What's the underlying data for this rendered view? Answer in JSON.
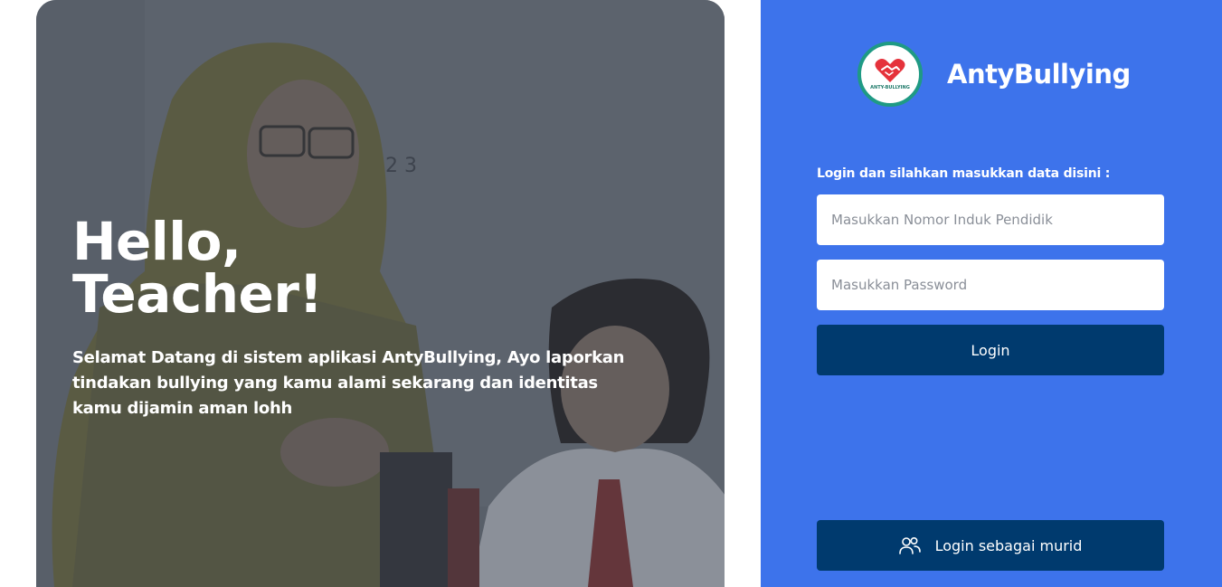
{
  "hero": {
    "title_line1": "Hello,",
    "title_line2": "Teacher!",
    "subtitle": "Selamat Datang di sistem aplikasi AntyBullying, Ayo laporkan tindakan bullying yang kamu alami sekarang dan identitas kamu dijamin aman lohh",
    "photo_text": "1 2 3"
  },
  "brand": {
    "name": "AntyBullying",
    "logo_text": "ANTY-BULLYING",
    "logo_icon": "heart-handshake-icon"
  },
  "login": {
    "prompt": "Login dan silahkan masukkan data disini :",
    "nip_placeholder": "Masukkan Nomor Induk Pendidik",
    "password_placeholder": "Masukkan Password",
    "submit_label": "Login",
    "student_login_label": "Login sebagai murid",
    "student_icon": "users-icon"
  },
  "colors": {
    "panel_bg": "#3d73eb",
    "button_bg": "#003a6e",
    "logo_ring": "#1f9a84",
    "logo_heart": "#e5323b"
  }
}
